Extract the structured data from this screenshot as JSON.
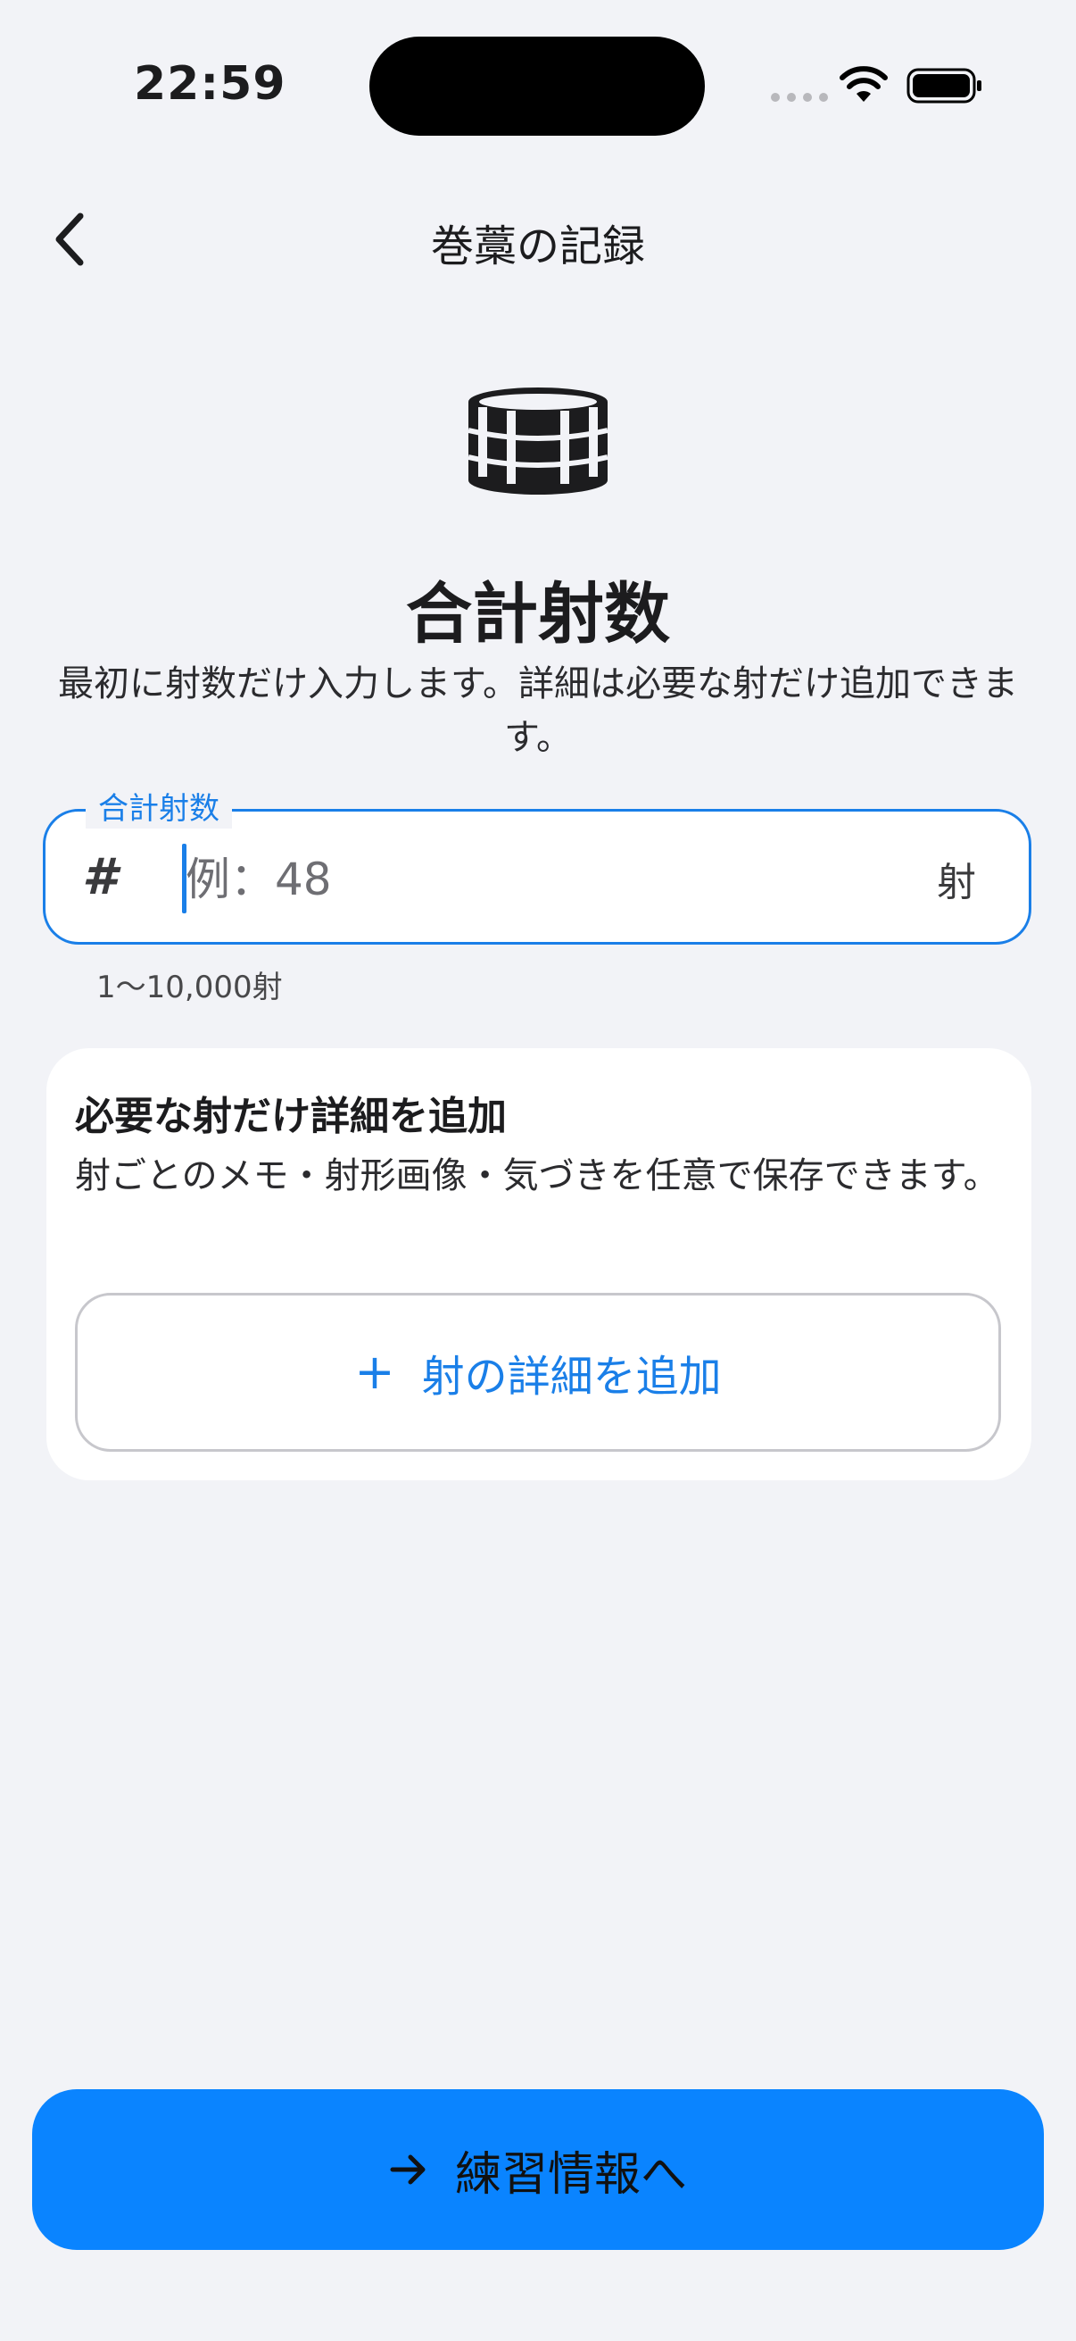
{
  "status_bar": {
    "time": "22:59"
  },
  "nav": {
    "title": "巻藁の記録"
  },
  "header": {
    "title": "合計射数",
    "description": "最初に射数だけ入力します。詳細は必要な射だけ追加できます。"
  },
  "count_field": {
    "label": "合計射数",
    "placeholder": "例：48",
    "value": "",
    "unit": "射",
    "hint": "1〜10,000射"
  },
  "detail_card": {
    "title": "必要な射だけ詳細を追加",
    "description": "射ごとのメモ・射形画像・気づきを任意で保存できます。",
    "add_button_label": "射の詳細を追加"
  },
  "footer": {
    "next_button_label": "練習情報へ"
  },
  "colors": {
    "accent": "#1a7fe8",
    "primary_button": "#0a84ff",
    "background": "#f2f3f7"
  },
  "icons": {
    "back": "chevron-left-icon",
    "hero": "makiwara-drum-icon",
    "field": "hash-icon",
    "add": "plus-icon",
    "next": "arrow-right-icon"
  }
}
